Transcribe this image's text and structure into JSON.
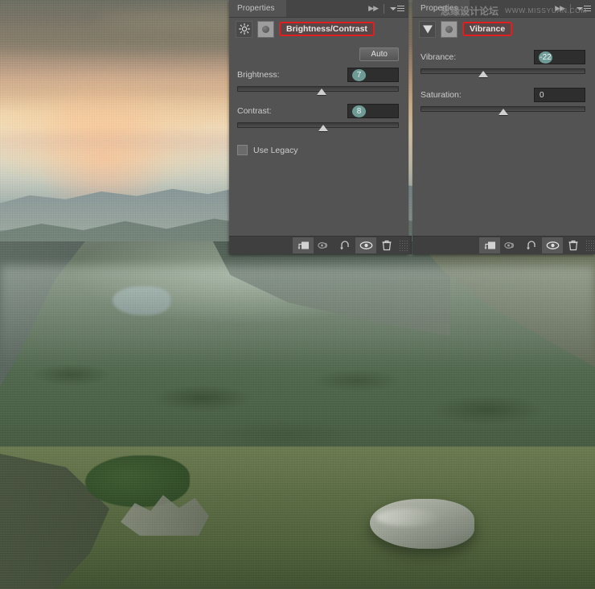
{
  "watermark": {
    "chinese": "思缘设计论坛",
    "url": "WWW.MISSYUAN.COM"
  },
  "panels": [
    {
      "id": "brightness-contrast",
      "tab_label": "Properties",
      "title": "Brightness/Contrast",
      "title_highlighted": true,
      "adjustment_icon": "brightness-contrast-icon",
      "auto_label": "Auto",
      "controls": [
        {
          "label": "Brightness:",
          "value": "7",
          "selected": true,
          "thumb_pct": 52
        },
        {
          "label": "Contrast:",
          "value": "8",
          "selected": true,
          "thumb_pct": 53
        }
      ],
      "checkbox": {
        "label": "Use Legacy",
        "checked": false
      },
      "footer_buttons": [
        "clip-to-layer-icon",
        "view-previous-state-icon",
        "reset-icon",
        "toggle-visibility-icon",
        "delete-layer-icon"
      ]
    },
    {
      "id": "vibrance",
      "tab_label": "Properties",
      "title": "Vibrance",
      "title_highlighted": true,
      "adjustment_icon": "vibrance-icon",
      "controls": [
        {
          "label": "Vibrance:",
          "value": "-22",
          "selected": true,
          "thumb_pct": 38
        },
        {
          "label": "Saturation:",
          "value": "0",
          "selected": false,
          "thumb_pct": 50
        }
      ],
      "footer_buttons": [
        "clip-to-layer-icon",
        "view-previous-state-icon",
        "reset-icon",
        "toggle-visibility-icon",
        "delete-layer-icon"
      ]
    }
  ],
  "colors": {
    "panel_bg": "#535353",
    "panel_bar": "#454545",
    "footer_bg": "#3f3f3f",
    "highlight_red": "#e02020",
    "value_badge": "#6f9b96",
    "text": "#cccccc"
  }
}
